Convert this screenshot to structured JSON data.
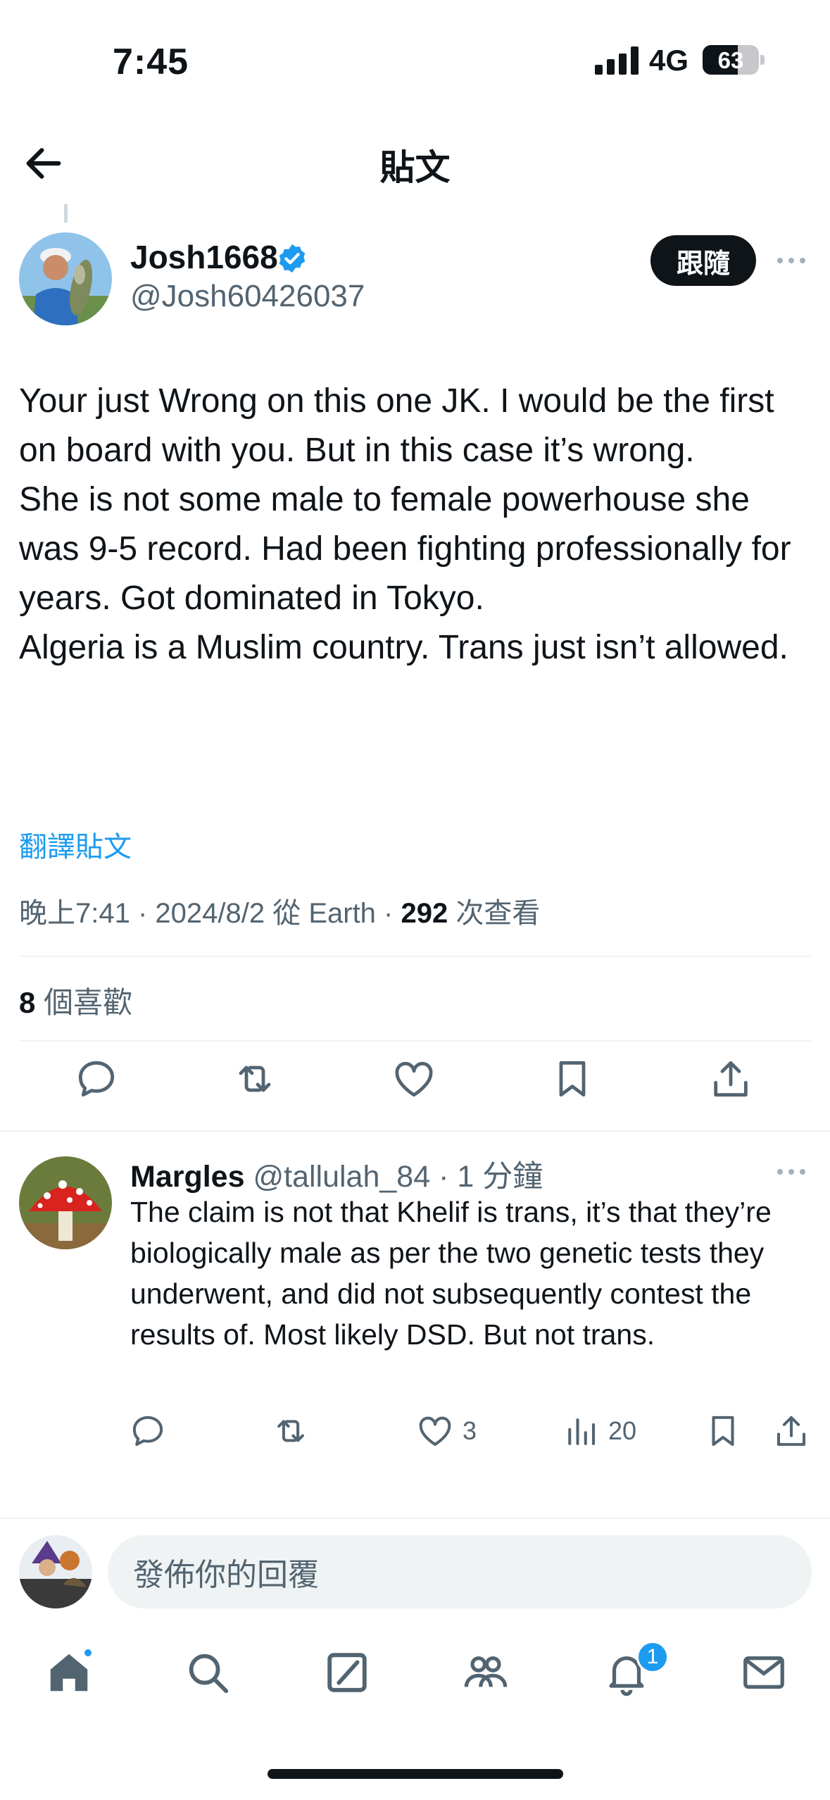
{
  "status_bar": {
    "time": "7:45",
    "network": "4G",
    "battery": "63",
    "battery_level": 0.63
  },
  "header": {
    "title": "貼文"
  },
  "post": {
    "author_name": "Josh1668",
    "author_handle": "@Josh60426037",
    "follow_label": "跟隨",
    "body": "Your just Wrong on this one JK. I would be the first on board with you. But in this case it’s wrong.\nShe is not some male to female powerhouse she was 9-5 record. Had been fighting professionally for years. Got dominated in Tokyo.\nAlgeria is a Muslim country. Trans just isn’t allowed.",
    "translate_label": "翻譯貼文",
    "meta_prefix": "晚上7:41 · 2024/8/2 從 Earth · ",
    "views_count": "292",
    "views_label": " 次查看",
    "likes_count": "8",
    "likes_label": " 個喜歡"
  },
  "reply": {
    "name": "Margles",
    "handle": "@tallulah_84",
    "time": " · 1 分鐘",
    "text": "The claim is not that Khelif is trans, it’s that they’re biologically male as per the two genetic tests they underwent, and did not subsequently contest the results of. Most likely DSD. But not trans.",
    "likes": "3",
    "views": "20"
  },
  "composer": {
    "placeholder": "發佈你的回覆"
  },
  "tabbar": {
    "notifications_count": "1"
  },
  "colors": {
    "accent": "#1d9bf0",
    "text": "#0f1419",
    "secondary": "#536471",
    "divider": "#eff3f4"
  }
}
